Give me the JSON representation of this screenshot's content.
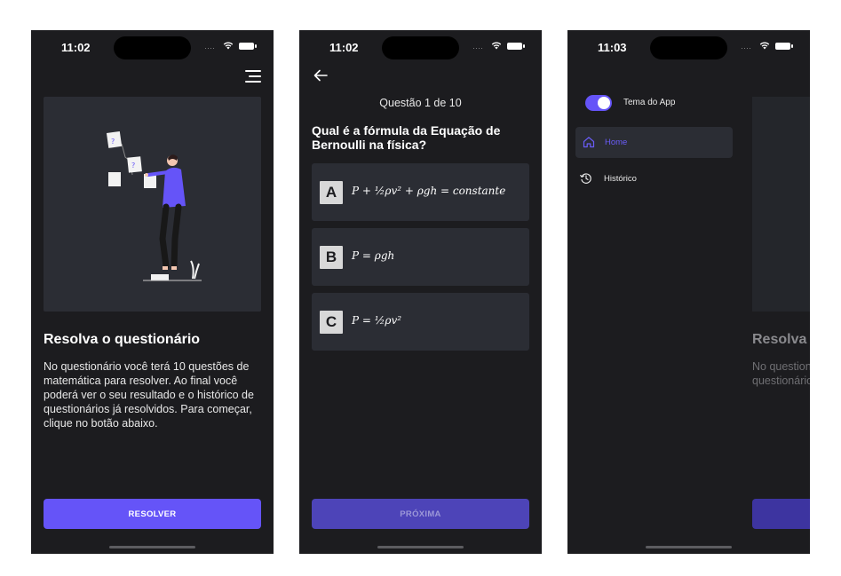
{
  "colors": {
    "background": "#1c1c1f",
    "card": "#2b2d34",
    "accent": "#6554f8",
    "accent_dim": "#4d44b8",
    "text": "#ffffff"
  },
  "screen1": {
    "status_time": "11:02",
    "menu_icon": "hamburger-menu-icon",
    "illustration": "person-with-question-notes",
    "title": "Resolva o questionário",
    "body": "No questionário você terá 10 questões de matemática para resolver. Ao final você poderá ver o seu resultado e o histórico de questionários já resolvidos. Para começar, clique no botão abaixo.",
    "button_label": "RESOLVER"
  },
  "screen2": {
    "status_time": "11:02",
    "back_icon": "arrow-left-icon",
    "counter": "Questão 1 de 10",
    "question": "Qual é a fórmula da Equação de Bernoulli na física?",
    "options": [
      {
        "letter": "A",
        "formula": "P + ½ρv² + ρgh = constante"
      },
      {
        "letter": "B",
        "formula": "P = ρgh"
      },
      {
        "letter": "C",
        "formula": "P = ½ρv²"
      }
    ],
    "next_label": "PRÓXIMA"
  },
  "screen3": {
    "status_time": "11:03",
    "theme_label": "Tema do App",
    "theme_on": true,
    "nav": [
      {
        "label": "Home",
        "icon": "home-icon",
        "active": true
      },
      {
        "label": "Histórico",
        "icon": "history-icon",
        "active": false
      }
    ],
    "dim_title": "Resolva",
    "dim_body": "No question matemática poderá ver o questionário clique no bot"
  }
}
